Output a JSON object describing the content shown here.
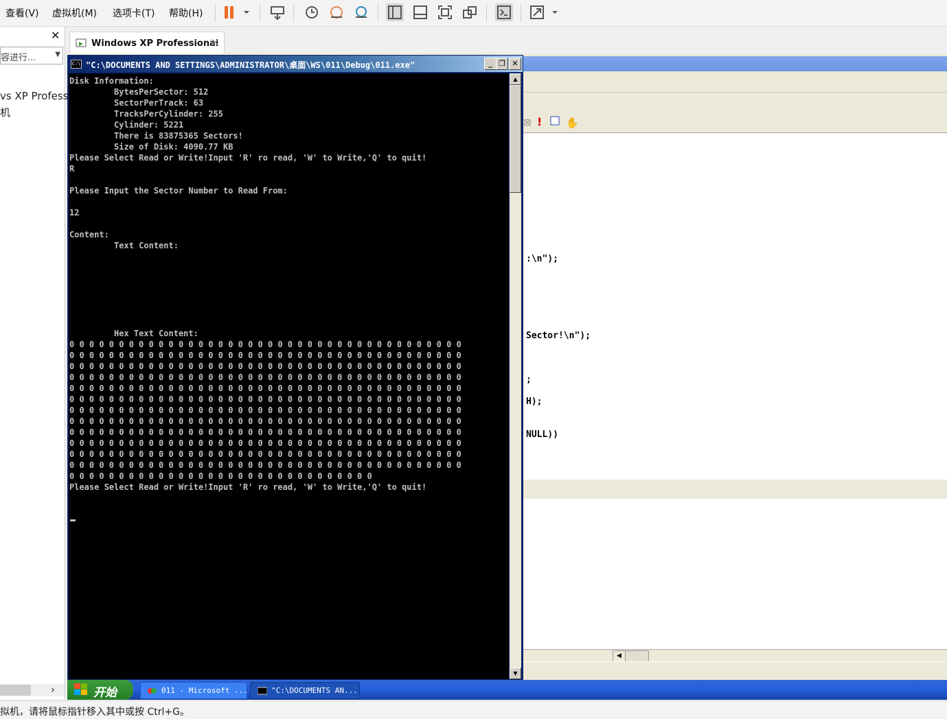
{
  "host": {
    "menu": {
      "view": "查看(V)",
      "vm": "虚拟机(M)",
      "tabs": "选项卡(T)",
      "help": "帮助(H)"
    },
    "accent_color": "#ee6c23",
    "library": {
      "search_placeholder": "容进行...",
      "vm_name": "vs XP Professi",
      "vm_sub": "机"
    },
    "tab_title": "Windows XP Professional",
    "status": "拟机，请将鼠标指针移入其中或按 Ctrl+G。"
  },
  "guest": {
    "console": {
      "title": "\"C:\\DOCUMENTS AND SETTINGS\\ADMINISTRATOR\\桌面\\WS\\011\\Debug\\011.exe\"",
      "icon_text": "C:\\",
      "lines": [
        "Disk Information:",
        "         BytesPerSector: 512",
        "         SectorPerTrack: 63",
        "         TracksPerCylinder: 255",
        "         Cylinder: 5221",
        "         There is 83875365 Sectors!",
        "         Size of Disk: 4090.77 KB",
        "Please Select Read or Write!Input 'R' ro read, 'W' to Write,'Q' to quit!",
        "R",
        "",
        "Please Input the Sector Number to Read From:",
        "",
        "12",
        "",
        "Content:",
        "         Text Content:",
        "",
        "",
        "",
        "",
        "",
        "",
        "",
        "         Hex Text Content:",
        "0 0 0 0 0 0 0 0 0 0 0 0 0 0 0 0 0 0 0 0 0 0 0 0 0 0 0 0 0 0 0 0 0 0 0 0 0 0 0 0",
        "0 0 0 0 0 0 0 0 0 0 0 0 0 0 0 0 0 0 0 0 0 0 0 0 0 0 0 0 0 0 0 0 0 0 0 0 0 0 0 0",
        "0 0 0 0 0 0 0 0 0 0 0 0 0 0 0 0 0 0 0 0 0 0 0 0 0 0 0 0 0 0 0 0 0 0 0 0 0 0 0 0",
        "0 0 0 0 0 0 0 0 0 0 0 0 0 0 0 0 0 0 0 0 0 0 0 0 0 0 0 0 0 0 0 0 0 0 0 0 0 0 0 0",
        "0 0 0 0 0 0 0 0 0 0 0 0 0 0 0 0 0 0 0 0 0 0 0 0 0 0 0 0 0 0 0 0 0 0 0 0 0 0 0 0",
        "0 0 0 0 0 0 0 0 0 0 0 0 0 0 0 0 0 0 0 0 0 0 0 0 0 0 0 0 0 0 0 0 0 0 0 0 0 0 0 0",
        "0 0 0 0 0 0 0 0 0 0 0 0 0 0 0 0 0 0 0 0 0 0 0 0 0 0 0 0 0 0 0 0 0 0 0 0 0 0 0 0",
        "0 0 0 0 0 0 0 0 0 0 0 0 0 0 0 0 0 0 0 0 0 0 0 0 0 0 0 0 0 0 0 0 0 0 0 0 0 0 0 0",
        "0 0 0 0 0 0 0 0 0 0 0 0 0 0 0 0 0 0 0 0 0 0 0 0 0 0 0 0 0 0 0 0 0 0 0 0 0 0 0 0",
        "0 0 0 0 0 0 0 0 0 0 0 0 0 0 0 0 0 0 0 0 0 0 0 0 0 0 0 0 0 0 0 0 0 0 0 0 0 0 0 0",
        "0 0 0 0 0 0 0 0 0 0 0 0 0 0 0 0 0 0 0 0 0 0 0 0 0 0 0 0 0 0 0 0 0 0 0 0 0 0 0 0",
        "0 0 0 0 0 0 0 0 0 0 0 0 0 0 0 0 0 0 0 0 0 0 0 0 0 0 0 0 0 0 0 0 0 0 0 0 0 0 0 0",
        "0 0 0 0 0 0 0 0 0 0 0 0 0 0 0 0 0 0 0 0 0 0 0 0 0 0 0 0 0 0 0",
        "Please Select Read or Write!Input 'R' ro read, 'W' to Write,'Q' to quit!"
      ]
    },
    "ide_code": {
      "line1": ":\\n\");",
      "line2": "Sector!\\n\");",
      "line3": ";",
      "line4": "H);",
      "line5": "NULL))"
    },
    "taskbar": {
      "start_label": "开始",
      "task1": "011 - Microsoft ...",
      "task2": "\"C:\\DOCUMENTS AN..."
    }
  }
}
